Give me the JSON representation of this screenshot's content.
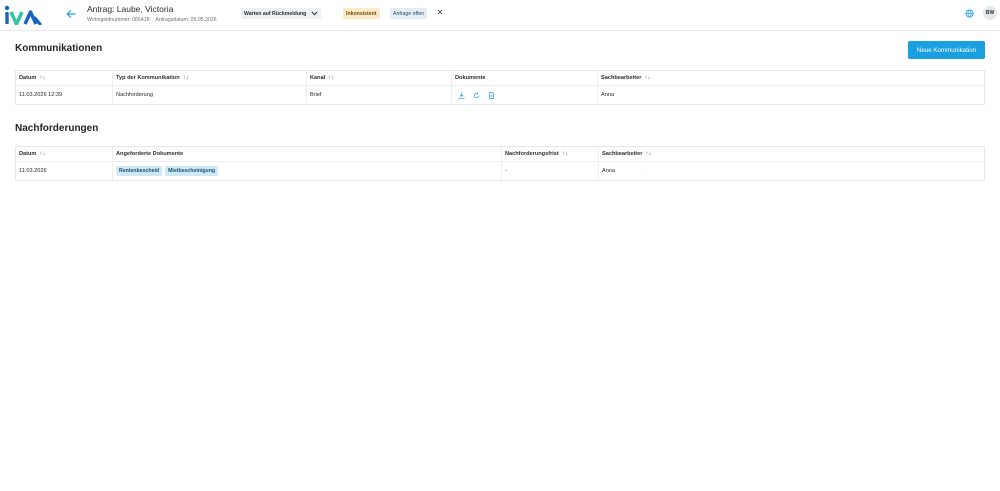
{
  "header": {
    "logo_text": "iva",
    "title": "Antrag: Laube, Victoria",
    "meta": {
      "wohngeldnummer": "Wohngeldnummer: 065418",
      "antragsdatum": "Antragsdatum: 05.05.2026"
    },
    "status_select": "Warten auf Rückmeldung",
    "badge_inconsistent": "Inkonsistent",
    "badge_request": "Anfrage offen",
    "close_label": "✕",
    "avatar_initials": "BW"
  },
  "kommunikationen": {
    "title": "Kommunikationen",
    "new_button": "Neue Kommunikation",
    "columns": {
      "datum": "Datum",
      "typ": "Typ der Kommunikation",
      "kanal": "Kanal",
      "dokumente": "Dokumente",
      "sachbearbeiter": "Sachbearbeiter"
    },
    "rows": [
      {
        "datum": "11.03.2026 12:39",
        "typ": "Nachforderung",
        "kanal": "Brief",
        "sachbearbeiter": "Anna"
      }
    ]
  },
  "nachforderungen": {
    "title": "Nachforderungen",
    "columns": {
      "datum": "Datum",
      "dokumente": "Angeforderte Dokumente",
      "frist": "Nachforderungsfrist",
      "sachbearbeiter": "Sachbearbeiter"
    },
    "rows": [
      {
        "datum": "11.03.2026",
        "chips": [
          "Rentenbescheid",
          "Mietbescheinigung"
        ],
        "frist": "-",
        "sachbearbeiter": "Anna",
        "trailing": ".."
      }
    ]
  },
  "sort_glyph": "↑↓",
  "colors": {
    "primary": "#1a9fe0",
    "logo_blue": "#1565c0",
    "logo_green": "#2ec4a0",
    "inconsistent_bg": "#fcebc6",
    "request_bg": "#e3eef7",
    "chip_bg": "#cfe8f5"
  },
  "icons": {
    "back": "arrow-left-icon",
    "status_select": "chevron-down-icon",
    "globe": "globe-icon",
    "doc_actions": [
      "download-icon",
      "refresh-icon",
      "document-icon"
    ]
  }
}
